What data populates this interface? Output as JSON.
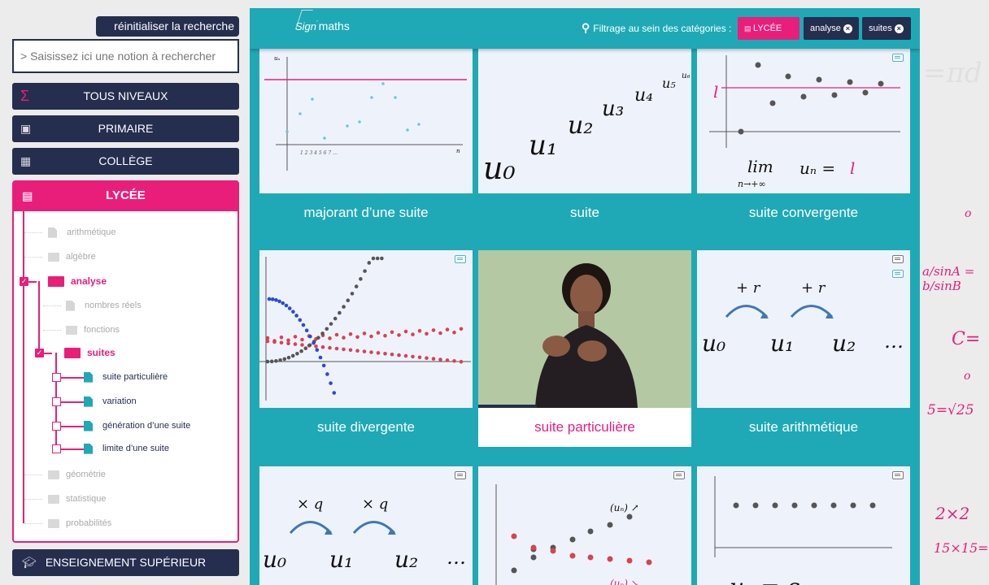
{
  "sidebar": {
    "reset_label": "réinitialiser la recherche",
    "search_placeholder": "> Saisissez ici une notion à rechercher",
    "levels": {
      "tous": "TOUS NIVEAUX",
      "primaire": "PRIMAIRE",
      "college": "COLLÈGE",
      "lycee": "LYCÉE",
      "superieur": "ENSEIGNEMENT SUPÉRIEUR"
    },
    "tree": {
      "arithmetique": "arithmétique",
      "algebre": "algèbre",
      "analyse": "analyse",
      "nombres_reels": "nombres réels",
      "fonctions": "fonctions",
      "suites": "suites",
      "suite_particuliere": "suite particulière",
      "variation": "variation",
      "generation": "génération d’une suite",
      "limite": "limite d’une suite",
      "geometrie": "géométrie",
      "statistique": "statistique",
      "probabilites": "probabilités"
    }
  },
  "header": {
    "logo_sign": "Sign",
    "logo_maths": "maths",
    "filter_label": "Filtrage au sein des catégories :",
    "chips": {
      "lycee": "LYCÉE",
      "analyse": "analyse",
      "suites": "suites"
    }
  },
  "cards": {
    "c1": "majorant d’une suite",
    "c2": "suite",
    "c3": "suite convergente",
    "c4": "suite divergente",
    "c5": "suite particulière",
    "c6": "suite arithmétique"
  },
  "colors": {
    "accent": "#e91e7a",
    "teal": "#1fa9b6",
    "navy": "#252e4e"
  }
}
